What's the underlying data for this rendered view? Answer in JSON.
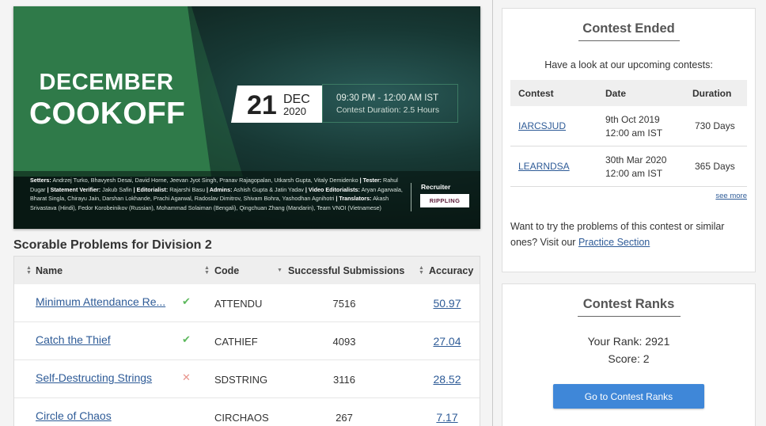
{
  "banner": {
    "title_line1": "DECEMBER",
    "title_line2": "COOKOFF",
    "date_day": "21",
    "date_month": "DEC",
    "date_year": "2020",
    "time_range": "09:30 PM - 12:00 AM IST",
    "duration": "Contest Duration: 2.5 Hours",
    "credits": [
      {
        "label": "Setters:",
        "text": " Andrzej Turko, Bhavyesh Desai, David Horne, Jeevan Jyot Singh, Pranav Rajagopalan, Utkarsh Gupta, Vitaly Demidenko"
      },
      {
        "label": "| Tester:",
        "text": " Rahul Dugar "
      },
      {
        "label": "| Statement Verifier:",
        "text": " Jakub Safin "
      },
      {
        "label": "| Editorialist:",
        "text": " Rajarshi Basu "
      },
      {
        "label": "| Admins:",
        "text": " Ashish Gupta & Jatin Yadav "
      },
      {
        "label": "| Video Editorialists:",
        "text": " Aryan Agarwala, Bharat Singla, Chirayu Jain, Darshan Lokhande, Prachi Agarwal, Radoslav Dimitrov, Shivam Bohra, Yashodhan Agnihotri "
      },
      {
        "label": "| Translators:",
        "text": " Akash Srivastava (Hindi), Fedor Korobeinikov (Russian), Mohammad Solaiman (Bengali), Qingchuan Zhang (Mandarin), Team VNOI (Vietnamese)"
      }
    ],
    "recruiter_label": "Recruiter",
    "recruiter_name": "RIPPLING"
  },
  "problems": {
    "heading": "Scorable Problems for Division 2",
    "columns": {
      "name": "Name",
      "code": "Code",
      "submissions": "Successful Submissions",
      "accuracy": "Accuracy"
    },
    "rows": [
      {
        "name": "Minimum Attendance Re...",
        "status": "✔",
        "status_color": "#5cb85c",
        "code": "ATTENDU",
        "submissions": "7516",
        "accuracy": "50.97"
      },
      {
        "name": "Catch the Thief",
        "status": "✔",
        "status_color": "#5cb85c",
        "code": "CATHIEF",
        "submissions": "4093",
        "accuracy": "27.04"
      },
      {
        "name": "Self-Destructing Strings",
        "status": "✕",
        "status_color": "#e8948c",
        "code": "SDSTRING",
        "submissions": "3116",
        "accuracy": "28.52"
      },
      {
        "name": "Circle of Chaos",
        "status": "",
        "status_color": "#ffffff",
        "code": "CIRCHAOS",
        "submissions": "267",
        "accuracy": "7.17"
      }
    ]
  },
  "contest_ended": {
    "title": "Contest Ended",
    "subtitle": "Have a look at our upcoming contests:",
    "columns": {
      "contest": "Contest",
      "date": "Date",
      "duration": "Duration"
    },
    "rows": [
      {
        "code": "IARCSJUD",
        "date_line1": "9th Oct 2019",
        "date_line2": "12:00 am IST",
        "duration": "730 Days"
      },
      {
        "code": "LEARNDSA",
        "date_line1": "30th Mar 2020",
        "date_line2": "12:00 am IST",
        "duration": "365 Days"
      }
    ],
    "see_more": "see more",
    "practice_text": "Want to try the problems of this contest or similar ones? Visit our ",
    "practice_link": "Practice Section"
  },
  "contest_ranks": {
    "title": "Contest Ranks",
    "your_rank": "Your Rank: 2921",
    "score": "Score: 2",
    "button": "Go to Contest Ranks"
  },
  "colors": {
    "accent": "#3f87d8",
    "link": "#2e5b97",
    "banner_green": "#2f7a49"
  }
}
